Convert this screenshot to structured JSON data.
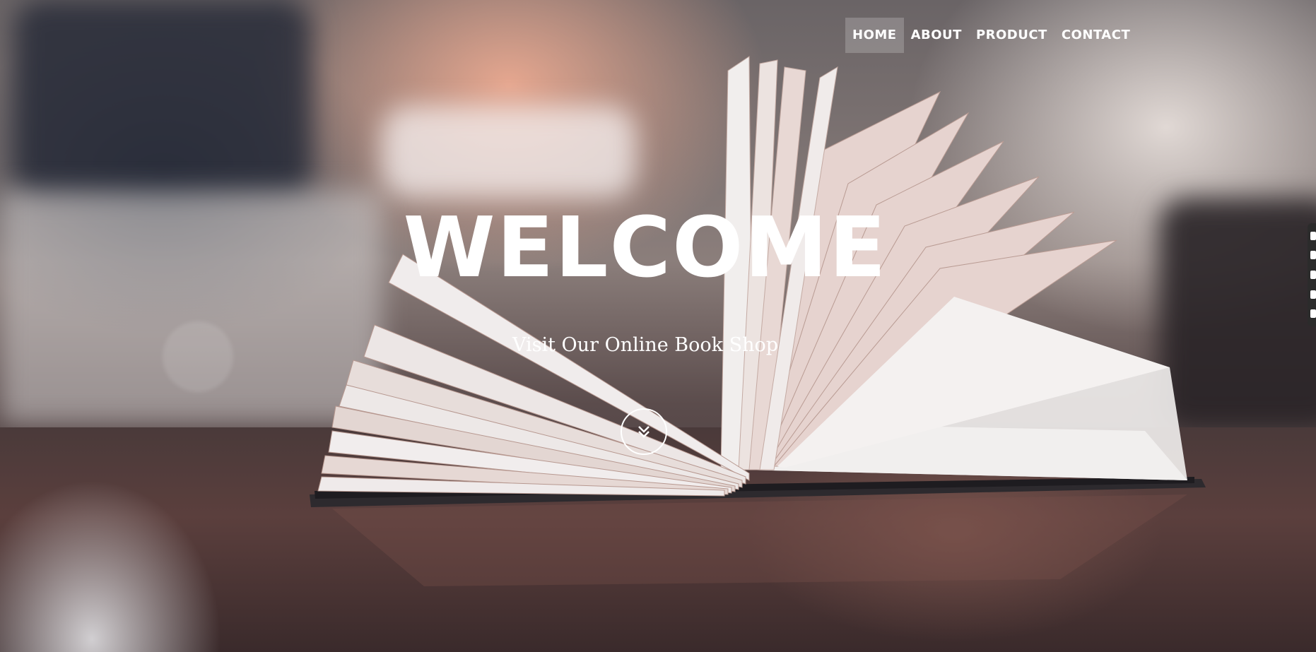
{
  "nav": {
    "items": [
      {
        "label": "HOME",
        "active": true
      },
      {
        "label": "ABOUT",
        "active": false
      },
      {
        "label": "PRODUCT",
        "active": false
      },
      {
        "label": "CONTACT",
        "active": false
      }
    ]
  },
  "hero": {
    "title": "WELCOME",
    "subtitle": "Visit Our Online Book Shop",
    "scroll_icon": "chevron-double-down-icon",
    "background": "open book on a wooden table photograph"
  },
  "side_toolbar": {
    "icons": [
      "star-icon",
      "square-icon",
      "square-icon",
      "copy-icon",
      "gear-icon"
    ]
  }
}
